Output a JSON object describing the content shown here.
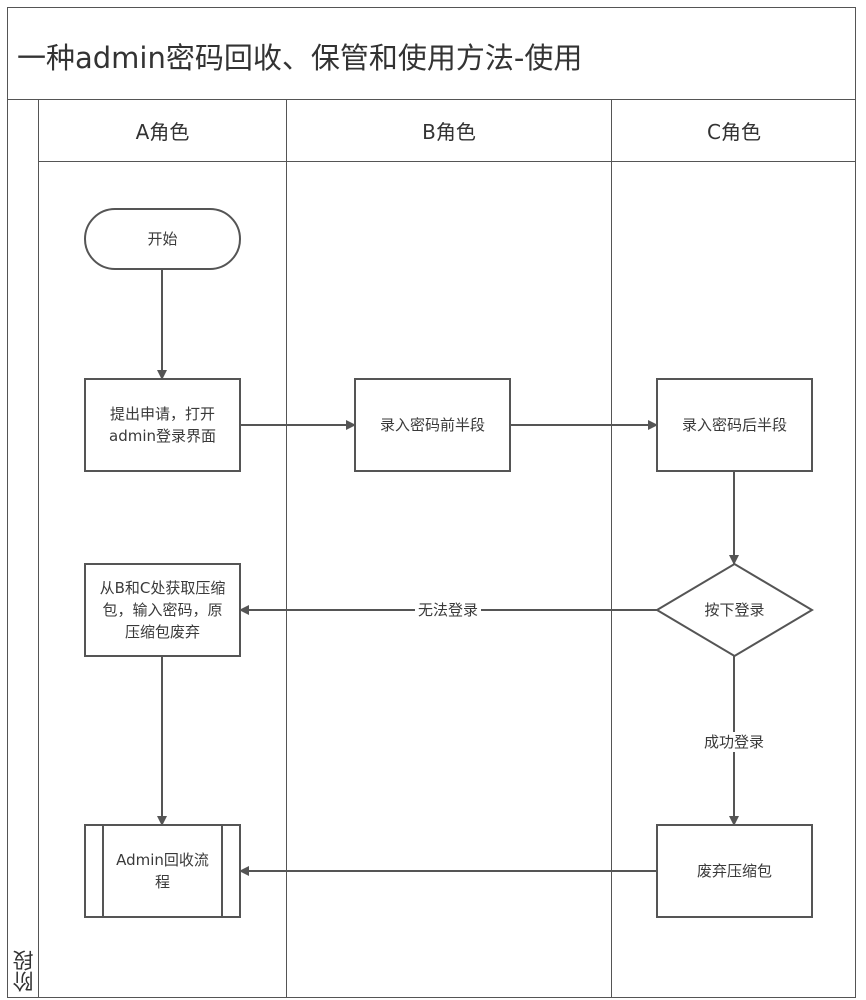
{
  "title": "一种admin密码回收、保管和使用方法-使用",
  "phase_label": "阶段",
  "lanes": [
    {
      "id": "A",
      "label": "A角色"
    },
    {
      "id": "B",
      "label": "B角色"
    },
    {
      "id": "C",
      "label": "C角色"
    }
  ],
  "nodes": {
    "start": {
      "shape": "terminator",
      "lane": "A",
      "lines": [
        "开始"
      ]
    },
    "apply": {
      "shape": "process",
      "lane": "A",
      "lines": [
        "提出申请，打开",
        "admin登录界面"
      ]
    },
    "enter_first": {
      "shape": "process",
      "lane": "B",
      "lines": [
        "录入密码前半段"
      ]
    },
    "enter_second": {
      "shape": "process",
      "lane": "C",
      "lines": [
        "录入密码后半段"
      ]
    },
    "press_login": {
      "shape": "decision",
      "lane": "C",
      "lines": [
        "按下登录"
      ]
    },
    "fetch_archive": {
      "shape": "process",
      "lane": "A",
      "lines": [
        "从B和C处获取压缩",
        "包，输入密码，原",
        "压缩包废弃"
      ]
    },
    "discard_archive": {
      "shape": "process",
      "lane": "C",
      "lines": [
        "废弃压缩包"
      ]
    },
    "recovery_flow": {
      "shape": "subprocess",
      "lane": "A",
      "lines": [
        "Admin回收流",
        "程"
      ]
    }
  },
  "edges": [
    {
      "from": "start",
      "to": "apply",
      "label": ""
    },
    {
      "from": "apply",
      "to": "enter_first",
      "label": ""
    },
    {
      "from": "enter_first",
      "to": "enter_second",
      "label": ""
    },
    {
      "from": "enter_second",
      "to": "press_login",
      "label": ""
    },
    {
      "from": "press_login",
      "to": "fetch_archive",
      "label": "无法登录"
    },
    {
      "from": "press_login",
      "to": "discard_archive",
      "label": "成功登录"
    },
    {
      "from": "fetch_archive",
      "to": "recovery_flow",
      "label": ""
    },
    {
      "from": "discard_archive",
      "to": "recovery_flow",
      "label": ""
    }
  ],
  "colors": {
    "stroke": "#555555",
    "text": "#3a3a3a",
    "background": "#ffffff"
  }
}
